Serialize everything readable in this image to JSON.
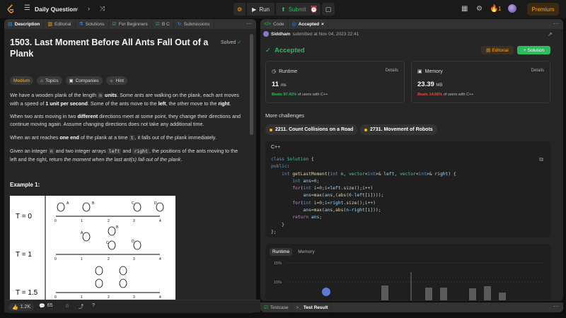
{
  "topbar": {
    "title": "Daily Question",
    "run_label": "Run",
    "submit_label": "Submit",
    "streak_count": "1",
    "premium_label": "Premium"
  },
  "left_tabs": [
    {
      "label": "Description",
      "icon": "description-icon"
    },
    {
      "label": "Editorial",
      "icon": "editorial-icon"
    },
    {
      "label": "Solutions",
      "icon": "solutions-icon"
    },
    {
      "label": "For Beginners",
      "icon": "checkbox-icon"
    },
    {
      "label": "B C",
      "icon": "checkbox-icon"
    },
    {
      "label": "Submissions",
      "icon": "submissions-icon"
    }
  ],
  "problem": {
    "title": "1503. Last Moment Before All Ants Fall Out of a Plank",
    "status": "Solved",
    "tags": [
      "Medium",
      "Topics",
      "Companies",
      "Hint"
    ],
    "p1_a": "We have a wooden plank of the length ",
    "p1_code": "n",
    "p1_b": " units",
    "p1_c": ". Some ants are walking on the plank, each ant moves with a speed of ",
    "p1_d": "1 unit per second",
    "p1_e": ". Some of the ants move to the ",
    "p1_f": "left",
    "p1_g": ", the other move to the ",
    "p1_h": "right",
    "p1_i": ".",
    "p2_a": "When two ants moving in two ",
    "p2_b": "different",
    "p2_c": " directions meet at some point, they change their directions and continue moving again. Assume changing directions does not take any additional time.",
    "p3_a": "When an ant reaches ",
    "p3_b": "one end",
    "p3_c": " of the plank at a time ",
    "p3_code": "t",
    "p3_d": ", it falls out of the plank immediately.",
    "p4_a": "Given an integer ",
    "p4_code1": "n",
    "p4_b": " and two integer arrays ",
    "p4_code2": "left",
    "p4_c": " and ",
    "p4_code3": "right",
    "p4_d": ", the positions of the ants moving to the left and the right, return ",
    "p4_e": "the moment when the last ant(s) fall out of the plank",
    "p4_f": ".",
    "example_title": "Example 1:",
    "diagram_labels": [
      "T = 0",
      "T = 1",
      "T = 1.5"
    ],
    "diagram_ticks": [
      "0",
      "1",
      "2",
      "3",
      "4"
    ],
    "diagram_ants": [
      "A",
      "B",
      "C",
      "D"
    ]
  },
  "left_footer": {
    "likes": "1.2K",
    "comments": "65"
  },
  "right_tabs": [
    {
      "label": "Code",
      "icon": "code-icon"
    },
    {
      "label": "Accepted",
      "icon": "accepted-icon"
    }
  ],
  "submission": {
    "user": "Siddham",
    "submitted_text": "submitted at Nov 04, 2023 22:41",
    "status": "Accepted",
    "editorial_label": "Editorial",
    "solution_label": "Solution",
    "runtime_label": "Runtime",
    "runtime_value": "11",
    "runtime_unit": "ms",
    "runtime_beats": "Beats 97.41%",
    "runtime_beats_suffix": "of users with C++",
    "memory_label": "Memory",
    "memory_value": "23.39",
    "memory_unit": "MB",
    "memory_beats": "Beats 14.66%",
    "memory_beats_suffix": "of users with C++",
    "details_label": "Details"
  },
  "more_challenges": {
    "title": "More challenges",
    "items": [
      "2211. Count Collisions on a Road",
      "2731. Movement of Robots"
    ]
  },
  "code": {
    "language": "C++"
  },
  "perf": {
    "tabs": [
      "Runtime",
      "Memory"
    ],
    "y_ticks": [
      "15%",
      "10%"
    ]
  },
  "bottom_tabs": [
    "Testcase",
    "Test Result"
  ],
  "colors": {
    "accent_green": "#2cbb5d",
    "accent_orange": "#ffa116",
    "medium_yellow": "#ffb800"
  }
}
